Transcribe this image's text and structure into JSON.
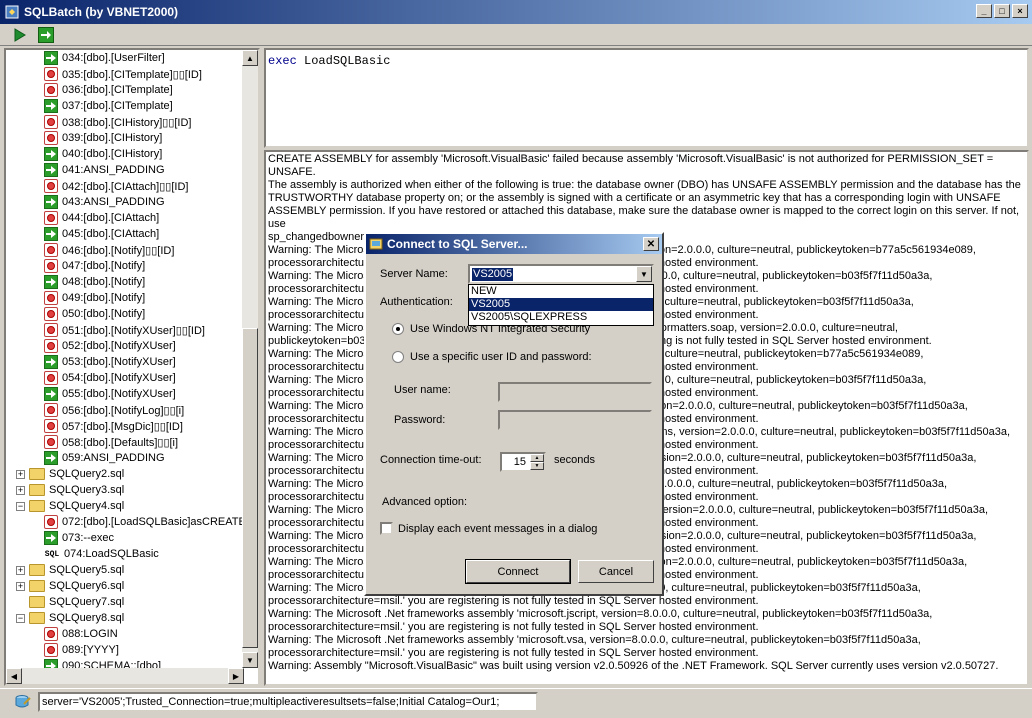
{
  "window": {
    "title": "SQLBatch (by VBNET2000)",
    "minimize": "_",
    "maximize": "□",
    "close": "×"
  },
  "toolbar": {
    "run_icon": "play-icon",
    "step_icon": "run-next-icon"
  },
  "tree": {
    "items": [
      {
        "label": "034:[dbo].[UserFilter]",
        "icon": "arrow"
      },
      {
        "label": "035:[dbo].[CITemplate]▯▯[ID]",
        "icon": "stop"
      },
      {
        "label": "036:[dbo].[CITemplate]",
        "icon": "stop"
      },
      {
        "label": "037:[dbo].[CITemplate]",
        "icon": "arrow"
      },
      {
        "label": "038:[dbo].[CIHistory]▯▯[ID]",
        "icon": "stop"
      },
      {
        "label": "039:[dbo].[CIHistory]",
        "icon": "stop"
      },
      {
        "label": "040:[dbo].[CIHistory]",
        "icon": "arrow"
      },
      {
        "label": "041:ANSI_PADDING",
        "icon": "arrow"
      },
      {
        "label": "042:[dbo].[CIAttach]▯▯[ID]",
        "icon": "stop"
      },
      {
        "label": "043:ANSI_PADDING",
        "icon": "arrow"
      },
      {
        "label": "044:[dbo].[CIAttach]",
        "icon": "stop"
      },
      {
        "label": "045:[dbo].[CIAttach]",
        "icon": "arrow"
      },
      {
        "label": "046:[dbo].[Notify]▯▯[ID]",
        "icon": "stop"
      },
      {
        "label": "047:[dbo].[Notify]",
        "icon": "stop"
      },
      {
        "label": "048:[dbo].[Notify]",
        "icon": "arrow"
      },
      {
        "label": "049:[dbo].[Notify]",
        "icon": "stop"
      },
      {
        "label": "050:[dbo].[Notify]",
        "icon": "stop"
      },
      {
        "label": "051:[dbo].[NotifyXUser]▯▯[ID]",
        "icon": "stop"
      },
      {
        "label": "052:[dbo].[NotifyXUser]",
        "icon": "stop"
      },
      {
        "label": "053:[dbo].[NotifyXUser]",
        "icon": "arrow"
      },
      {
        "label": "054:[dbo].[NotifyXUser]",
        "icon": "stop"
      },
      {
        "label": "055:[dbo].[NotifyXUser]",
        "icon": "arrow"
      },
      {
        "label": "056:[dbo].[NotifyLog]▯▯[i]",
        "icon": "stop"
      },
      {
        "label": "057:[dbo].[MsgDic]▯▯[ID]",
        "icon": "stop"
      },
      {
        "label": "058:[dbo].[Defaults]▯▯[i]",
        "icon": "stop"
      },
      {
        "label": "059:ANSI_PADDING",
        "icon": "arrow"
      },
      {
        "label": "SQLQuery2.sql",
        "icon": "folder",
        "expander": "+"
      },
      {
        "label": "SQLQuery3.sql",
        "icon": "folder",
        "expander": "+"
      },
      {
        "label": "SQLQuery4.sql",
        "icon": "folder",
        "expander": "−"
      },
      {
        "label": "072:[dbo].[LoadSQLBasic]asCREATE",
        "icon": "stop"
      },
      {
        "label": "073:--exec",
        "icon": "arrow"
      },
      {
        "label": "074:LoadSQLBasic",
        "icon": "sql"
      },
      {
        "label": "SQLQuery5.sql",
        "icon": "folder",
        "expander": "+"
      },
      {
        "label": "SQLQuery6.sql",
        "icon": "folder",
        "expander": "+"
      },
      {
        "label": "SQLQuery7.sql",
        "icon": "folder"
      },
      {
        "label": "SQLQuery8.sql",
        "icon": "folder",
        "expander": "−"
      },
      {
        "label": "088:LOGIN",
        "icon": "stop"
      },
      {
        "label": "089:[YYYY]",
        "icon": "stop"
      },
      {
        "label": "090:SCHEMA::[dbo]",
        "icon": "arrow"
      }
    ]
  },
  "editor": {
    "keyword": "exec",
    "rest": " LoadSQLBasic"
  },
  "output": {
    "lines": [
      "CREATE ASSEMBLY for assembly 'Microsoft.VisualBasic' failed because assembly 'Microsoft.VisualBasic' is not authorized for PERMISSION_SET = UNSAFE.",
      "The assembly is authorized when either of the following is true: the database owner (DBO) has UNSAFE ASSEMBLY permission and the database has the",
      "TRUSTWORTHY database property on; or the assembly is signed with a certificate or an asymmetric key that has a corresponding login with UNSAFE",
      "ASSEMBLY permission. If you have restored or attached this database, make sure the database owner is mapped to the correct login on this server. If not, use",
      "sp_changedbowner to fix the problem.",
      "Warning: The Microsoft .Net frameworks assembly 'system.windows.forms, version=2.0.0.0, culture=neutral, publickeytoken=b77a5c561934e089,",
      "processorarchitecture=msil.' you are registering is not fully tested in SQL Server hosted environment.",
      "Warning: The Microsoft .Net frameworks assembly 'system.drawing, version=2.0.0.0, culture=neutral, publickeytoken=b03f5f7f11d50a3a,",
      "processorarchitecture=msil.' you are registering is not fully tested in SQL Server hosted environment.",
      "Warning: The Microsoft .Net frameworks assembly 'accessibility, version=2.0.0.0, culture=neutral, publickeytoken=b03f5f7f11d50a3a,",
      "processorarchitecture=msil.' you are registering is not fully tested in SQL Server hosted environment.",
      "Warning: The Microsoft .Net frameworks assembly 'system.runtime.serialization.formatters.soap, version=2.0.0.0, culture=neutral,",
      "publickeytoken=b03f5f7f11d50a3a, processorarchitecture=msil.' you are registering is not fully tested in SQL Server hosted environment.",
      "Warning: The Microsoft .Net frameworks assembly 'system.web, version=2.0.0.0, culture=neutral, publickeytoken=b77a5c561934e089,",
      "processorarchitecture=msil.' you are registering is not fully tested in SQL Server hosted environment.",
      "Warning: The Microsoft .Net frameworks assembly 'system.design, version=2.0.0.0, culture=neutral, publickeytoken=b03f5f7f11d50a3a,",
      "processorarchitecture=msil.' you are registering is not fully tested in SQL Server hosted environment.",
      "Warning: The Microsoft .Net frameworks assembly 'system.drawing.design, version=2.0.0.0, culture=neutral, publickeytoken=b03f5f7f11d50a3a,",
      "processorarchitecture=msil.' you are registering is not fully tested in SQL Server hosted environment.",
      "Warning: The Microsoft .Net frameworks assembly 'system.web.regularexpressions, version=2.0.0.0, culture=neutral, publickeytoken=b03f5f7f11d50a3a,",
      "processorarchitecture=msil.' you are registering is not fully tested in SQL Server hosted environment.",
      "Warning: The Microsoft .Net frameworks assembly 'system.directoryservices, version=2.0.0.0, culture=neutral, publickeytoken=b03f5f7f11d50a3a,",
      "processorarchitecture=msil.' you are registering is not fully tested in SQL Server hosted environment.",
      "Warning: The Microsoft .Net frameworks assembly 'system.messaging, version=2.0.0.0, culture=neutral, publickeytoken=b03f5f7f11d50a3a,",
      "processorarchitecture=msil.' you are registering is not fully tested in SQL Server hosted environment.",
      "Warning: The Microsoft .Net frameworks assembly 'system.configuration.install, version=2.0.0.0, culture=neutral, publickeytoken=b03f5f7f11d50a3a,",
      "processorarchitecture=msil.' you are registering is not fully tested in SQL Server hosted environment.",
      "Warning: The Microsoft .Net frameworks assembly 'system.runtime.remoting, version=2.0.0.0, culture=neutral, publickeytoken=b03f5f7f11d50a3a,",
      "processorarchitecture=msil.' you are registering is not fully tested in SQL Server hosted environment.",
      "Warning: The Microsoft .Net frameworks assembly 'system.serviceprocess, version=2.0.0.0, culture=neutral, publickeytoken=b03f5f7f11d50a3a,",
      "processorarchitecture=msil.' you are registering is not fully tested in SQL Server hosted environment.",
      "Warning: The Microsoft .Net frameworks assembly 'microsoft.vsa, version=8.0.0.0, culture=neutral, publickeytoken=b03f5f7f11d50a3a,",
      "processorarchitecture=msil.' you are registering is not fully tested in SQL Server hosted environment.",
      "Warning: The Microsoft .Net frameworks assembly 'microsoft.jscript, version=8.0.0.0, culture=neutral, publickeytoken=b03f5f7f11d50a3a,",
      "processorarchitecture=msil.' you are registering is not fully tested in SQL Server hosted environment.",
      "Warning: The Microsoft .Net frameworks assembly 'microsoft.vsa, version=8.0.0.0, culture=neutral, publickeytoken=b03f5f7f11d50a3a,",
      "processorarchitecture=msil.' you are registering is not fully tested in SQL Server hosted environment.",
      "Warning: Assembly \"Microsoft.VisualBasic\" was built using version v2.0.50926 of the .NET Framework. SQL Server currently uses version v2.0.50727."
    ]
  },
  "status": {
    "connection_string": "server='VS2005';Trusted_Connection=true;multipleactiveresultsets=false;Initial Catalog=Our1;"
  },
  "dialog": {
    "title": "Connect to SQL Server...",
    "server_label": "Server Name:",
    "server_value": "VS2005",
    "server_options": [
      "NEW",
      "VS2005",
      "VS2005\\SQLEXPRESS"
    ],
    "server_selected_index": 1,
    "auth_label": "Authentication:",
    "radio_windows": "Use Windows NT Integrated Security",
    "radio_specific": "Use a specific user ID and password:",
    "user_label": "User name:",
    "password_label": "Password:",
    "timeout_label": "Connection time-out:",
    "timeout_value": "15",
    "timeout_unit": "seconds",
    "advanced_label": "Advanced option:",
    "checkbox_label": "Display each event messages in a dialog",
    "connect_label": "Connect",
    "cancel_label": "Cancel"
  }
}
